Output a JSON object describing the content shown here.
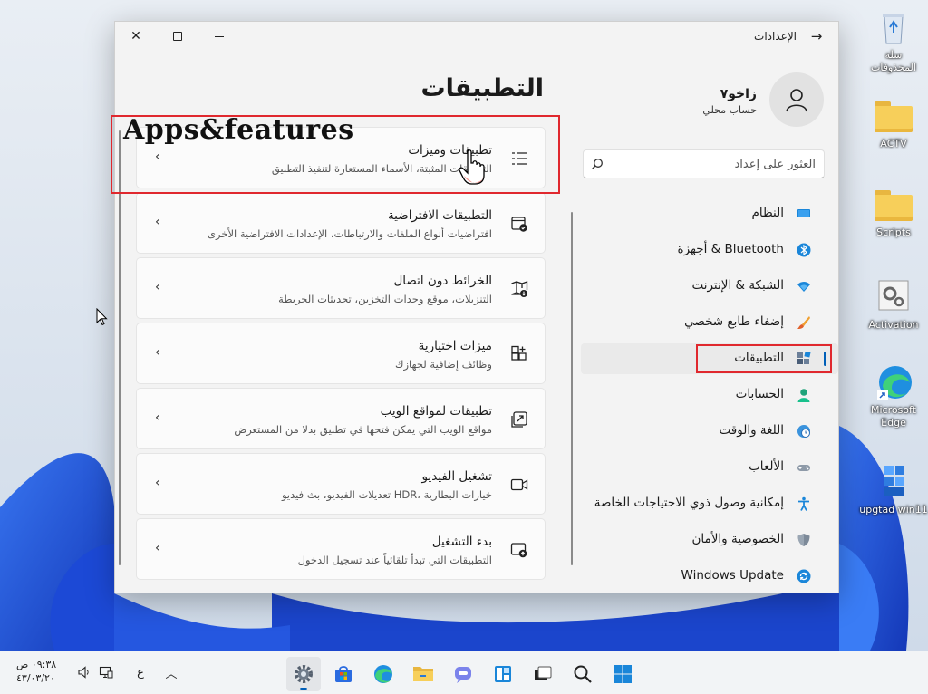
{
  "window": {
    "title": "الإعدادات"
  },
  "profile": {
    "name": "زاخو٧",
    "account_type": "حساب محلي"
  },
  "search": {
    "placeholder": "العثور على إعداد"
  },
  "nav": {
    "items": [
      {
        "label": "النظام",
        "icon": "monitor-icon"
      },
      {
        "label": "أجهزة & Bluetooth",
        "icon": "bluetooth-icon"
      },
      {
        "label": "الشبكة & الإنترنت",
        "icon": "wifi-icon"
      },
      {
        "label": "إضفاء طابع شخصي",
        "icon": "brush-icon"
      },
      {
        "label": "التطبيقات",
        "icon": "apps-icon",
        "active": true
      },
      {
        "label": "الحسابات",
        "icon": "person-icon"
      },
      {
        "label": "اللغة والوقت",
        "icon": "globe-clock-icon"
      },
      {
        "label": "الألعاب",
        "icon": "gamepad-icon"
      },
      {
        "label": "إمكانية وصول ذوي الاحتياجات الخاصة",
        "icon": "accessibility-icon"
      },
      {
        "label": "الخصوصية والأمان",
        "icon": "shield-icon"
      },
      {
        "label": "Windows Update",
        "icon": "update-icon"
      }
    ]
  },
  "main": {
    "title": "التطبيقات",
    "cards": [
      {
        "title": "تطبيقات وميزات",
        "subtitle": "التطبيقات المثبتة، الأسماء المستعارة لتنفيذ التطبيق",
        "icon": "list-icon"
      },
      {
        "title": "التطبيقات الافتراضية",
        "subtitle": "افتراضيات أنواع الملفات والارتباطات، الإعدادات الافتراضية الأخرى",
        "icon": "default-apps-icon"
      },
      {
        "title": "الخرائط دون اتصال",
        "subtitle": "التنزيلات، موقع وحدات التخزين، تحديثات الخريطة",
        "icon": "map-icon"
      },
      {
        "title": "ميزات اختيارية",
        "subtitle": "وظائف إضافية لجهازك",
        "icon": "add-feature-icon"
      },
      {
        "title": "تطبيقات لمواقع الويب",
        "subtitle": "مواقع الويب التي يمكن فتحها في تطبيق بدلا من المستعرض",
        "icon": "web-app-icon"
      },
      {
        "title": "تشغيل الفيديو",
        "subtitle": "تعديلات الفيديو، بث فيديو HDR، خيارات البطارية",
        "icon": "video-icon"
      },
      {
        "title": "بدء التشغيل",
        "subtitle": "التطبيقات التي تبدأ تلقائياً عند تسجيل الدخول",
        "icon": "startup-icon"
      }
    ]
  },
  "annotation": {
    "label": "Apps&features"
  },
  "desktop": {
    "icons": [
      {
        "label": "سلة المحذوفات"
      },
      {
        "label": "ACTV"
      },
      {
        "label": "Scripts"
      },
      {
        "label": "Activation"
      },
      {
        "label": "Microsoft Edge"
      },
      {
        "label": "upgtad win11"
      }
    ]
  },
  "taskbar": {
    "time": "٠٩:٣٨ ص",
    "date": "٤٣/٠٣/٢٠",
    "language": "ع"
  },
  "colors": {
    "accent": "#005fb8",
    "annotation_red": "#e0282e"
  }
}
